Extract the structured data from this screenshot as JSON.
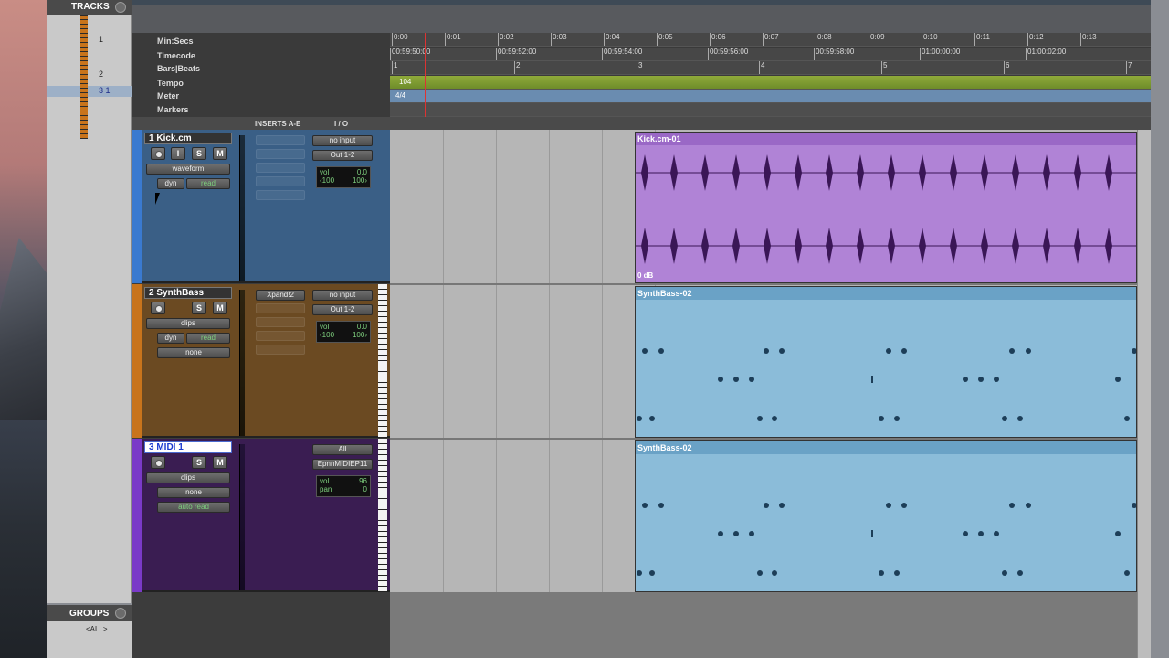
{
  "tracks_panel": {
    "title": "TRACKS",
    "rows": [
      "1",
      "2",
      "3 1"
    ]
  },
  "groups_panel": {
    "title": "GROUPS",
    "all_label": "<ALL>"
  },
  "rulers": {
    "min_secs": "Min:Secs",
    "timecode": "Timecode",
    "bars_beats": "Bars|Beats",
    "tempo": "Tempo",
    "meter": "Meter",
    "markers": "Markers",
    "min_secs_ticks": [
      "0:00",
      "0:01",
      "0:02",
      "0:03",
      "0:04",
      "0:05",
      "0:06",
      "0:07",
      "0:08",
      "0:09",
      "0:10",
      "0:11",
      "0:12",
      "0:13"
    ],
    "timecode_ticks": [
      "00:59:50:00",
      "00:59:52:00",
      "00:59:54:00",
      "00:59:56:00",
      "00:59:58:00",
      "01:00:00:00",
      "01:00:02:00"
    ],
    "bars_ticks": [
      "1",
      "2",
      "3",
      "4",
      "5",
      "6",
      "7"
    ],
    "tempo_value": "104",
    "meter_value": "4/4"
  },
  "columns": {
    "inserts": "INSERTS A-E",
    "io": "I / O"
  },
  "tracks": [
    {
      "number": "1",
      "name": "Kick.cm",
      "view": "waveform",
      "dyn": "dyn",
      "auto": "read",
      "input": "no input",
      "output": "Out 1-2",
      "vol_label": "vol",
      "vol": "0.0",
      "pan_l": "‹100",
      "pan_r": "100›",
      "clip": "Kick.cm-01",
      "clip_gain": "0 dB",
      "color": "#3a7ad0"
    },
    {
      "number": "2",
      "name": "SynthBass",
      "view": "clips",
      "dyn": "dyn",
      "auto": "read",
      "extra": "none",
      "insert": "Xpand!2",
      "input": "no input",
      "output": "Out 1-2",
      "vol_label": "vol",
      "vol": "0.0",
      "pan_l": "‹100",
      "pan_r": "100›",
      "clip": "SynthBass-02",
      "color": "#c8741c"
    },
    {
      "number": "3",
      "name": "MIDI 1",
      "view": "clips",
      "extra": "none",
      "auto": "auto read",
      "input": "All",
      "output": "EpnnMIDIEP11",
      "vol_label": "vol",
      "vol": "96",
      "pan_label": "pan",
      "pan": "0",
      "clip": "SynthBass-02",
      "color": "#7a3ac8"
    }
  ],
  "buttons": {
    "solo": "S",
    "mute": "M",
    "input_mon": "I"
  }
}
